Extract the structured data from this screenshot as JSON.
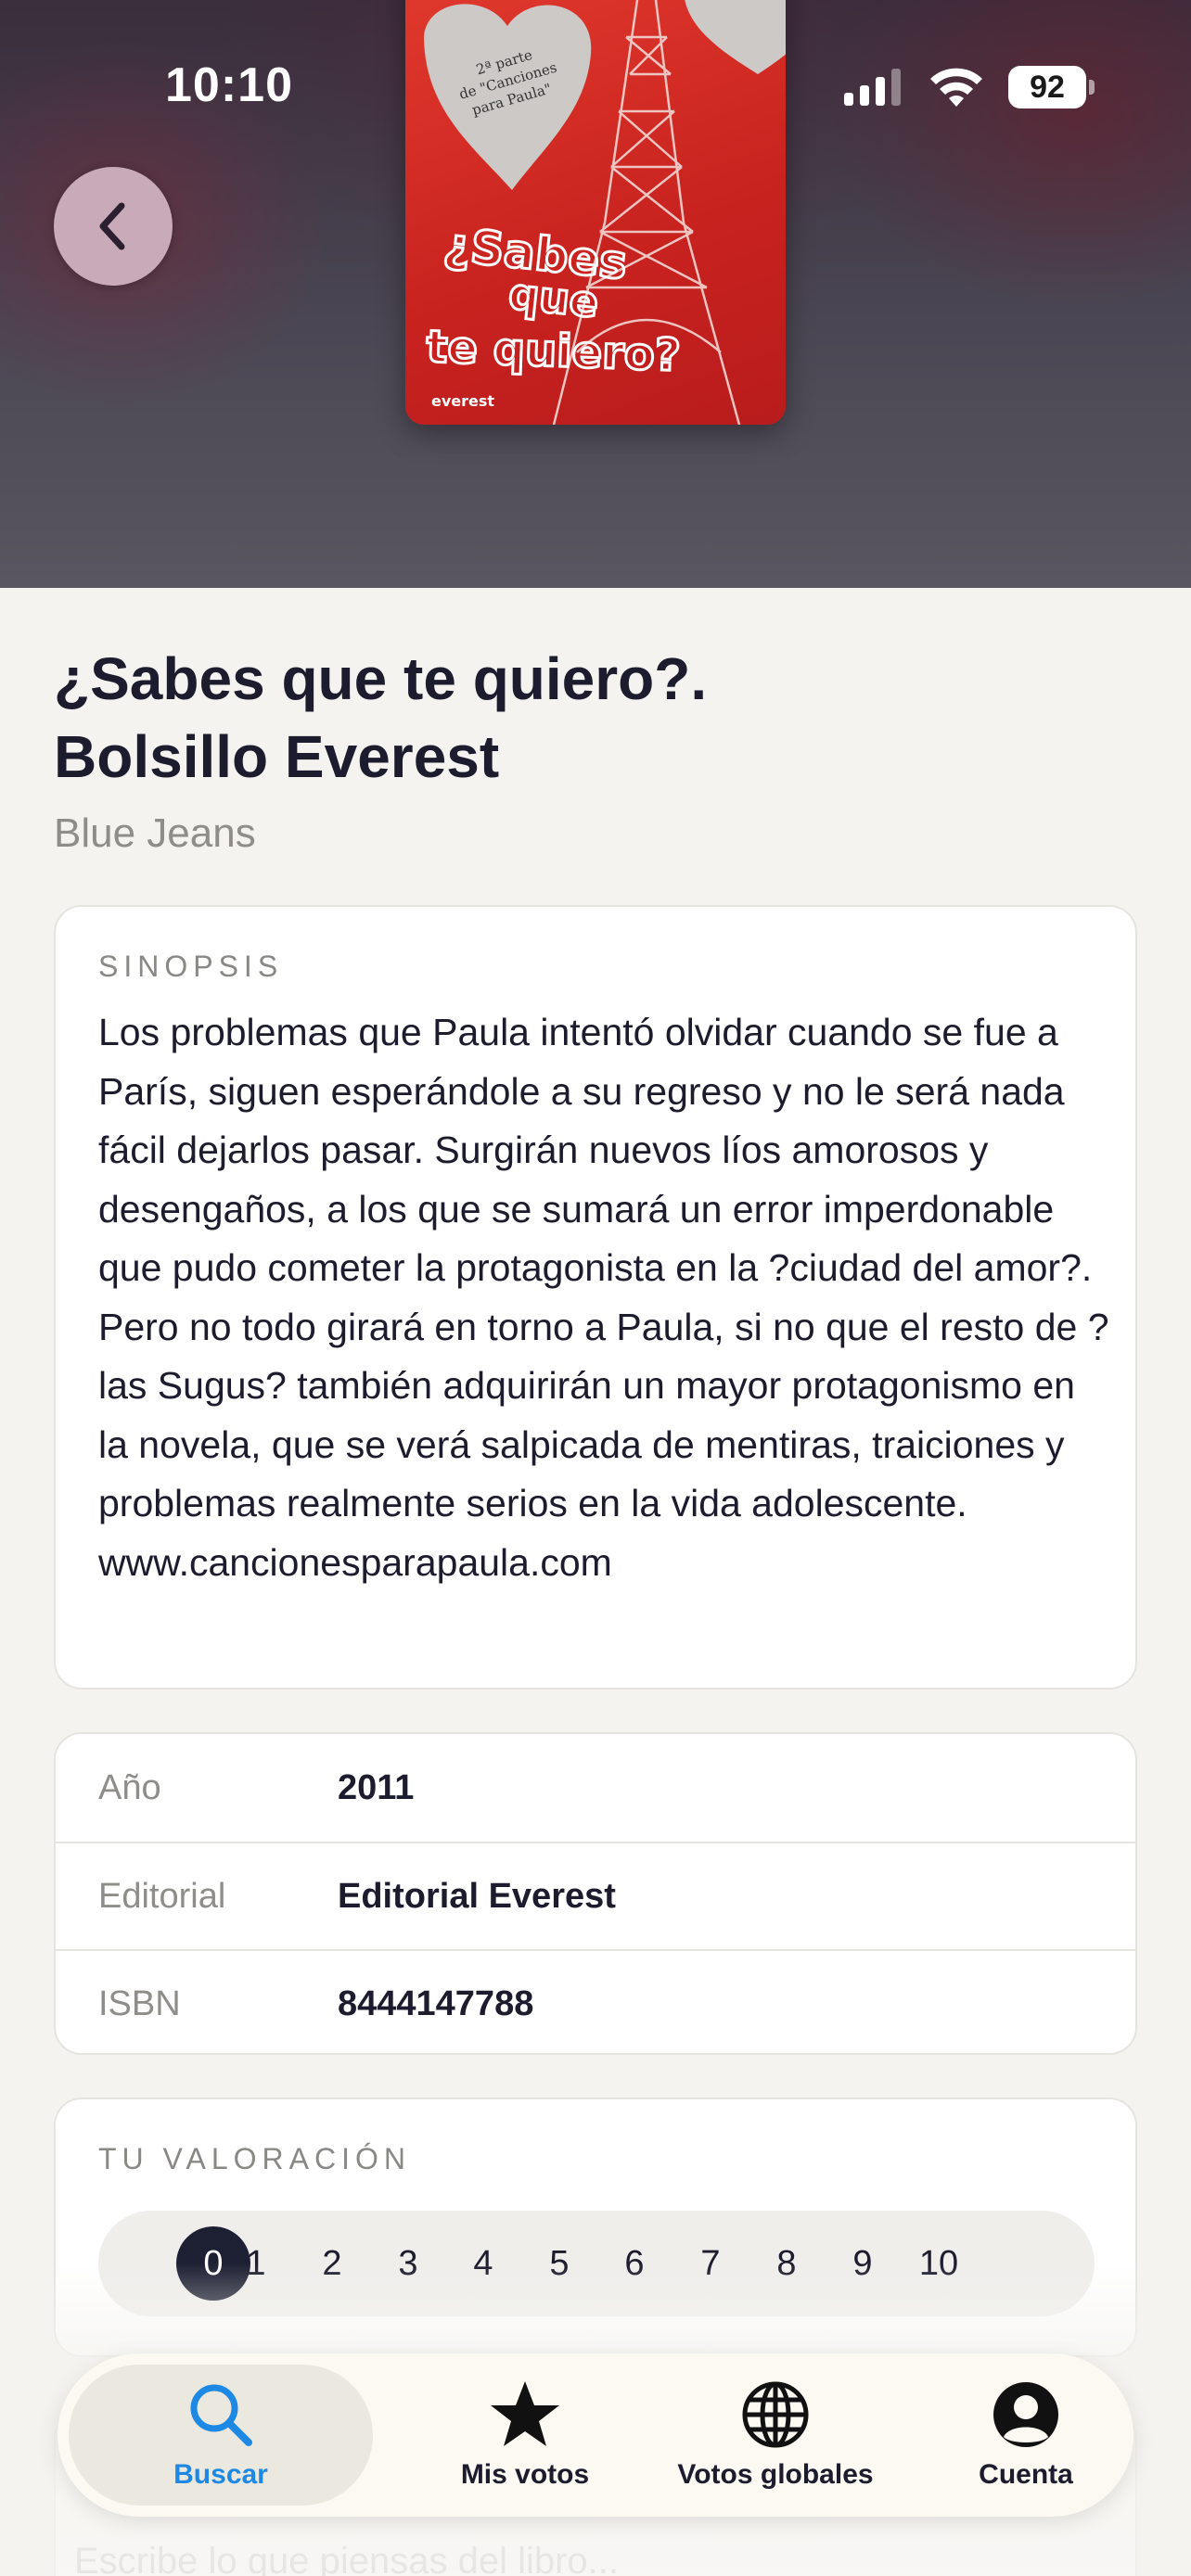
{
  "status_bar": {
    "time": "10:10",
    "battery": "92",
    "icons": [
      "cellular-signal-icon",
      "wifi-icon",
      "battery-icon"
    ]
  },
  "nav": {
    "back_icon": "chevron-left-icon"
  },
  "cover": {
    "lines_top": [
      "2ª parte",
      "de \"Canciones",
      "para Paula\""
    ],
    "title_lines": [
      "¿Sabes",
      "que",
      "te quiero?"
    ],
    "publisher_mark": "everest"
  },
  "book": {
    "title_line1": "¿Sabes que te quiero?.",
    "title_line2": "Bolsillo Everest",
    "author": "Blue Jeans"
  },
  "synopsis": {
    "label": "SINOPSIS",
    "text": "Los problemas que Paula intentó olvidar cuando se fue a París, siguen esperándole a su regreso y no le será nada fácil dejarlos pasar. Surgirán nuevos líos amorosos y desengaños, a los que se sumará un error imperdonable que pudo cometer la protagonista en la ?ciudad del amor?. Pero no todo girará en torno a Paula, si no que el resto de ?las Sugus? también adquirirán un mayor protagonismo en la novela, que se verá salpicada de mentiras, traiciones y problemas realmente serios en la vida adolescente. www.cancionesparapaula.com"
  },
  "details": [
    {
      "key": "Año",
      "value": "2011"
    },
    {
      "key": "Editorial",
      "value": "Editorial Everest"
    },
    {
      "key": "ISBN",
      "value": "8444147788"
    }
  ],
  "rating": {
    "label": "TU VALORACIÓN",
    "options": [
      "0",
      "1",
      "2",
      "3",
      "4",
      "5",
      "6",
      "7",
      "8",
      "9",
      "10"
    ],
    "selected": "0"
  },
  "comment": {
    "placeholder": "Escribe lo que piensas del libro..."
  },
  "tab_bar": {
    "tabs": [
      {
        "label": "Buscar",
        "icon": "search-icon",
        "active": true
      },
      {
        "label": "Mis votos",
        "icon": "star-icon",
        "active": false
      },
      {
        "label": "Votos globales",
        "icon": "globe-icon",
        "active": false
      },
      {
        "label": "Cuenta",
        "icon": "account-icon",
        "active": false
      }
    ],
    "active_color": "#1e88e5"
  },
  "colors": {
    "background": "#f4f3ef",
    "accent": "#1e88e5",
    "selected_rating": "#1d1f33",
    "cover_red": "#d32b25"
  }
}
